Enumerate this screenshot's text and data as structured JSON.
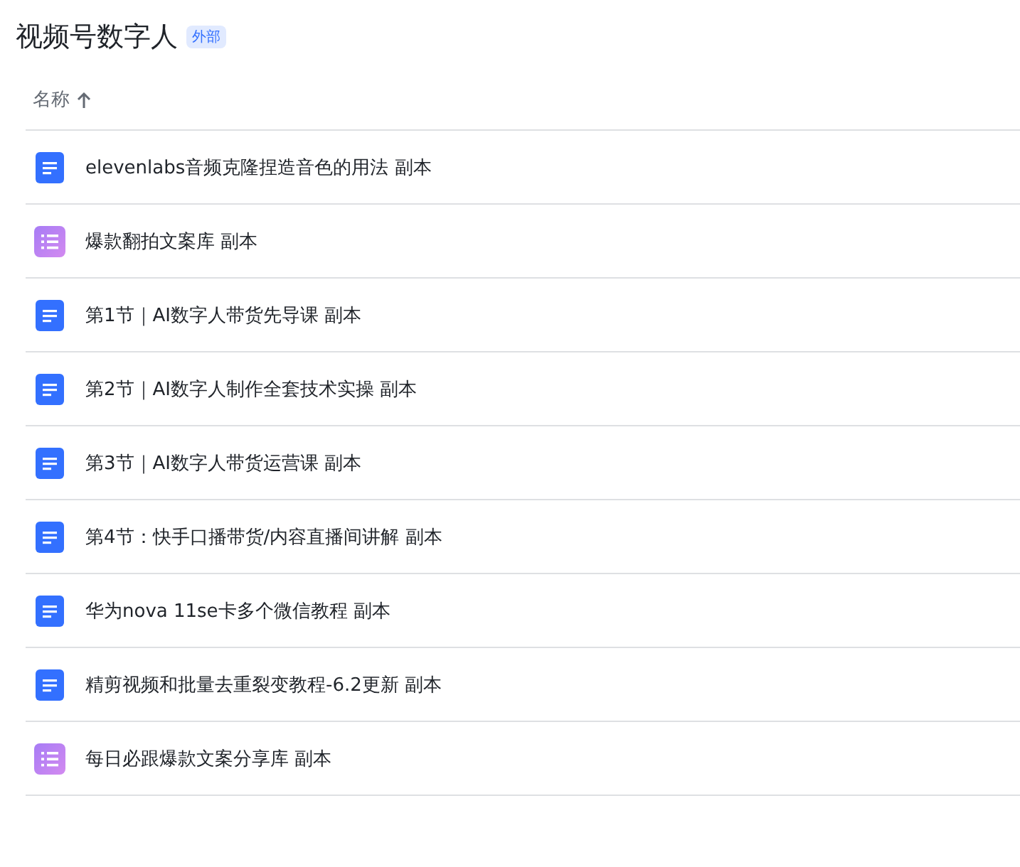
{
  "folder": {
    "title": "视频号数字人",
    "badge": "外部"
  },
  "table": {
    "columns": [
      {
        "label": "名称",
        "sorted_ascending": true
      }
    ],
    "rows": [
      {
        "name": "elevenlabs音频克隆捏造音色的用法 副本",
        "kind": "doc"
      },
      {
        "name": "爆款翻拍文案库 副本",
        "kind": "list"
      },
      {
        "name": "第1节｜AI数字人带货先导课 副本",
        "kind": "doc"
      },
      {
        "name": "第2节｜AI数字人制作全套技术实操 副本",
        "kind": "doc"
      },
      {
        "name": "第3节｜AI数字人带货运营课 副本",
        "kind": "doc"
      },
      {
        "name": "第4节：快手口播带货/内容直播间讲解 副本",
        "kind": "doc"
      },
      {
        "name": "华为nova 11se卡多个微信教程 副本",
        "kind": "doc"
      },
      {
        "name": "精剪视频和批量去重裂变教程-6.2更新 副本",
        "kind": "doc"
      },
      {
        "name": "每日必跟爆款文案分享库 副本",
        "kind": "list"
      }
    ]
  }
}
